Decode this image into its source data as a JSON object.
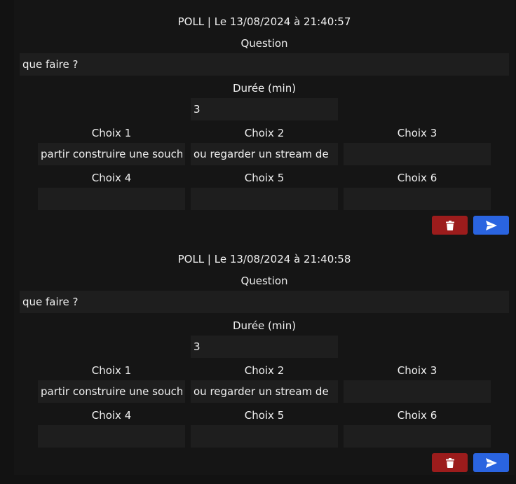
{
  "colors": {
    "background": "#121212",
    "panel": "#151515",
    "field": "#1e1e1e",
    "delete_button": "#9c1c1c",
    "send_button": "#2a64e0"
  },
  "polls": [
    {
      "header": "POLL | Le 13/08/2024 à 21:40:57",
      "question_label": "Question",
      "question_value": "que faire ?",
      "duration_label": "Durée (min)",
      "duration_value": "3",
      "choices": [
        {
          "label": "Choix 1",
          "value": "partir construire une souche"
        },
        {
          "label": "Choix 2",
          "value": "ou regarder un stream de"
        },
        {
          "label": "Choix 3",
          "value": ""
        },
        {
          "label": "Choix 4",
          "value": ""
        },
        {
          "label": "Choix 5",
          "value": ""
        },
        {
          "label": "Choix 6",
          "value": ""
        }
      ],
      "delete_icon": "trash-icon",
      "send_icon": "send-icon"
    },
    {
      "header": "POLL | Le 13/08/2024 à 21:40:58",
      "question_label": "Question",
      "question_value": "que faire ?",
      "duration_label": "Durée (min)",
      "duration_value": "3",
      "choices": [
        {
          "label": "Choix 1",
          "value": "partir construire une souche"
        },
        {
          "label": "Choix 2",
          "value": "ou regarder un stream de"
        },
        {
          "label": "Choix 3",
          "value": ""
        },
        {
          "label": "Choix 4",
          "value": ""
        },
        {
          "label": "Choix 5",
          "value": ""
        },
        {
          "label": "Choix 6",
          "value": ""
        }
      ],
      "delete_icon": "trash-icon",
      "send_icon": "send-icon"
    }
  ]
}
